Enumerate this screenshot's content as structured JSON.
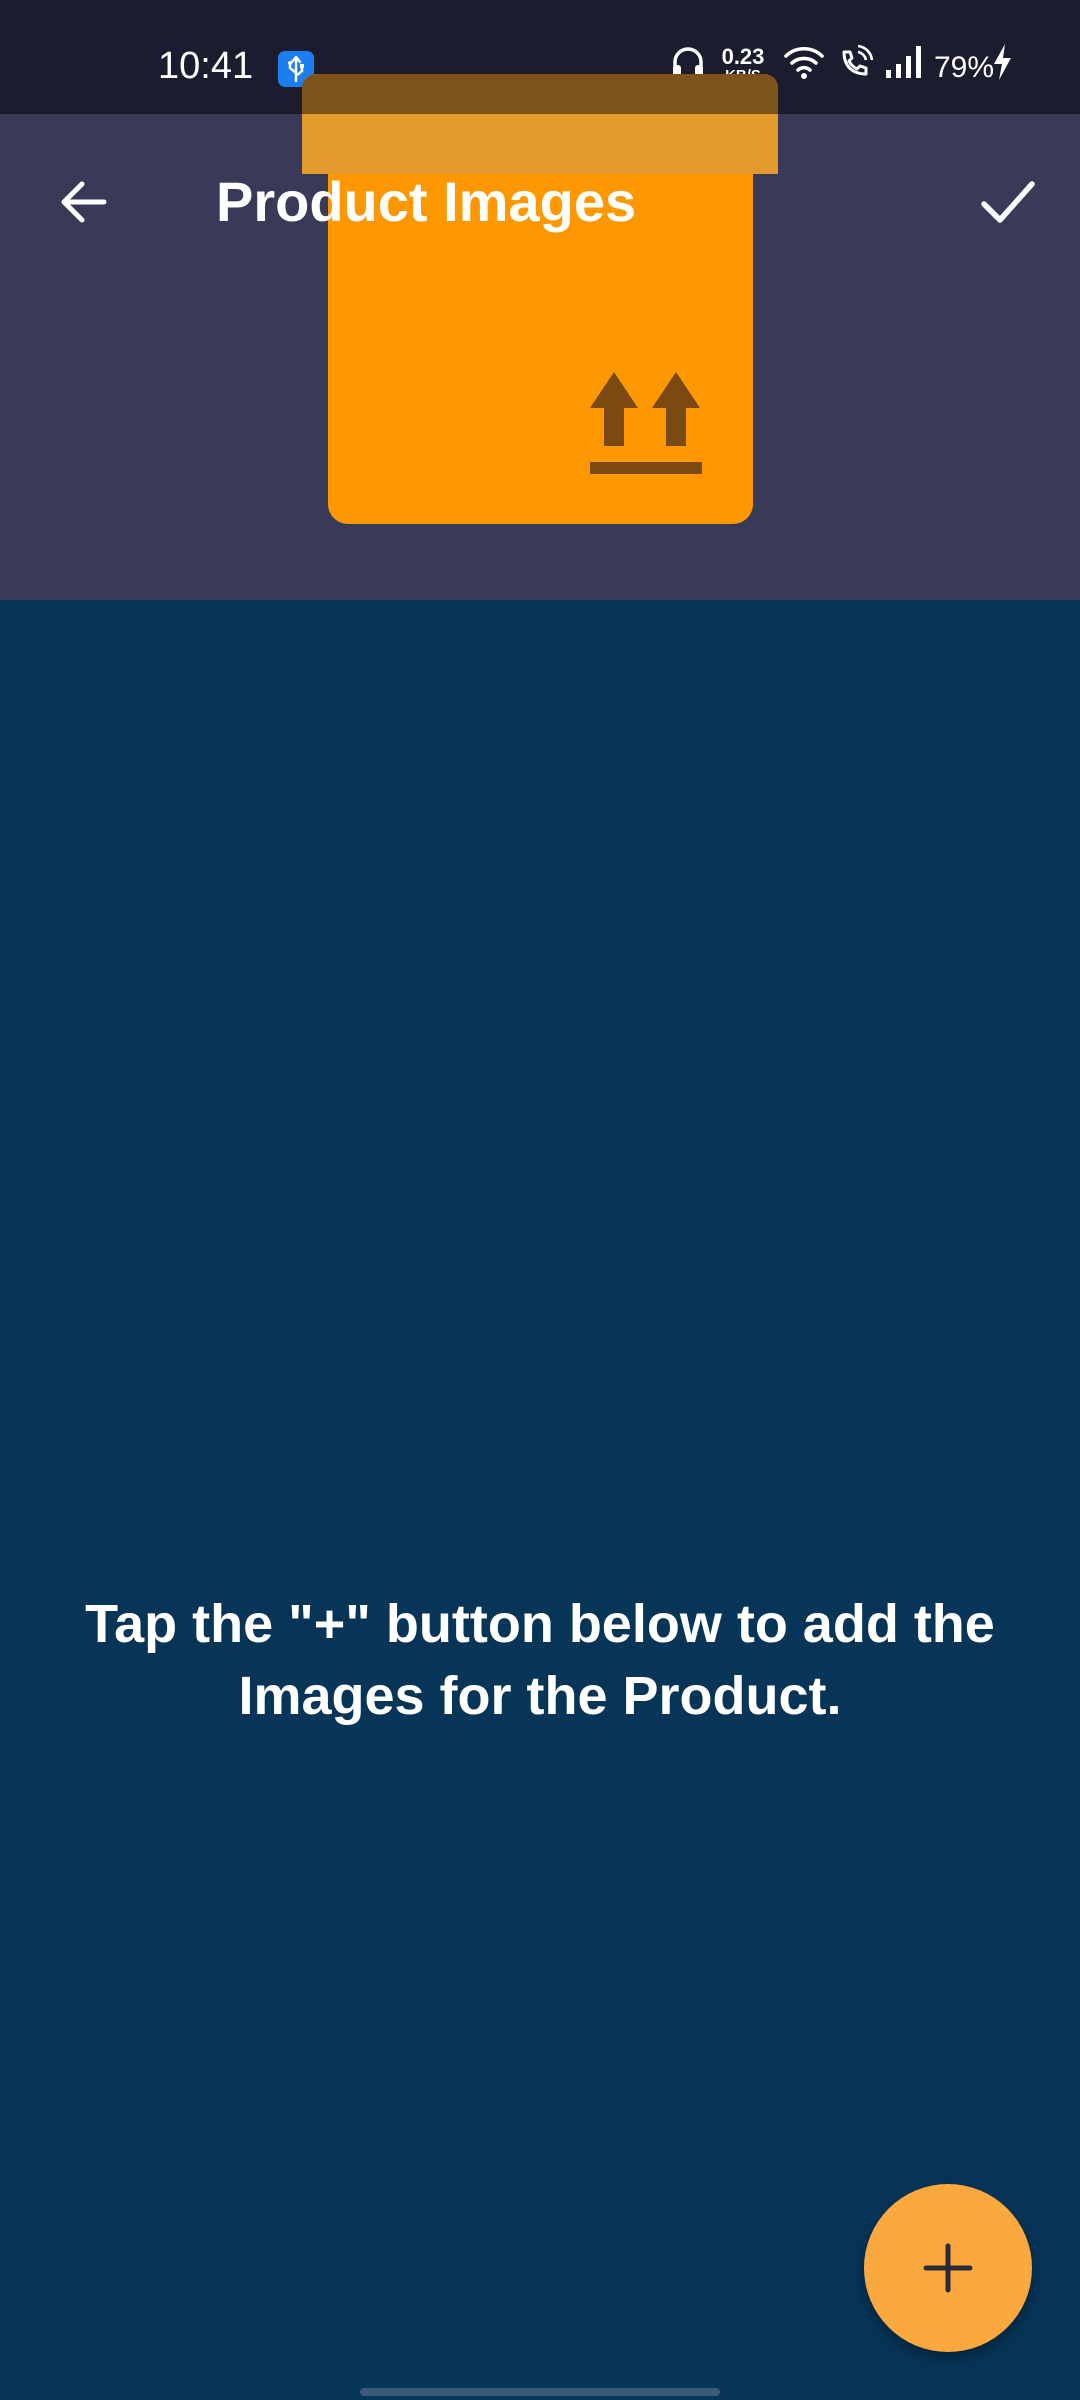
{
  "status_bar": {
    "time": "10:41",
    "net_speed_value": "0.23",
    "net_speed_unit": "KB/S",
    "battery_percent": "79%",
    "icons": [
      "usb-icon",
      "headphones-icon",
      "wifi-icon",
      "wifi-call-icon",
      "signal-icon",
      "charging-icon"
    ]
  },
  "app_bar": {
    "title": "Product Images",
    "back_icon": "arrow-left-icon",
    "confirm_icon": "check-icon",
    "illustration": "package-box-icon"
  },
  "main": {
    "empty_message": "Tap the \"+\" button below to add the Images for the Product."
  },
  "fab": {
    "icon": "plus-icon"
  },
  "colors": {
    "status_bar": "#1b1c2d",
    "app_bar": "#393a58",
    "background": "#073558",
    "box_orange": "#ff9800",
    "fab": "#fba93e"
  }
}
